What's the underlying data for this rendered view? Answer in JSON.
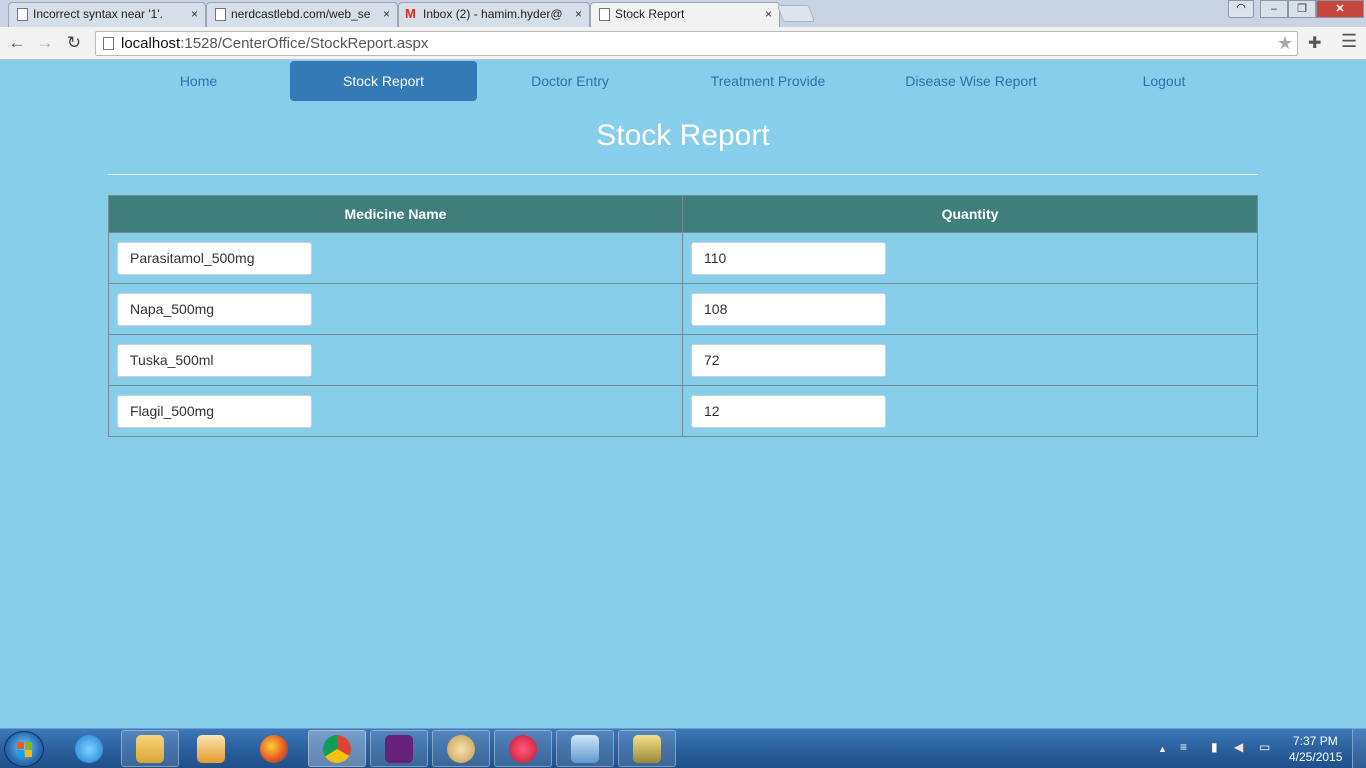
{
  "browser": {
    "tabs": [
      {
        "title": "Incorrect syntax near '1'.",
        "icon": "page-icon",
        "active": false
      },
      {
        "title": "nerdcastlebd.com/web_se",
        "icon": "page-icon",
        "active": false
      },
      {
        "title": "Inbox (2) - hamim.hyder@",
        "icon": "gmail-icon",
        "active": false
      },
      {
        "title": "Stock Report",
        "icon": "page-icon",
        "active": true
      }
    ],
    "close_glyph": "×",
    "url_host": "localhost",
    "url_path": ":1528/CenterOffice/StockReport.aspx"
  },
  "nav": {
    "items": [
      {
        "label": "Home",
        "active": false
      },
      {
        "label": "Stock Report",
        "active": true
      },
      {
        "label": "Doctor Entry",
        "active": false
      },
      {
        "label": "Treatment Provide",
        "active": false
      },
      {
        "label": "Disease Wise Report",
        "active": false
      },
      {
        "label": "Logout",
        "active": false
      }
    ]
  },
  "page": {
    "title": "Stock Report"
  },
  "table": {
    "headers": [
      "Medicine Name",
      "Quantity"
    ],
    "rows": [
      {
        "name": "Parasitamol_500mg",
        "quantity": "110"
      },
      {
        "name": "Napa_500mg",
        "quantity": "108"
      },
      {
        "name": "Tuska_500ml",
        "quantity": "72"
      },
      {
        "name": "Flagil_500mg",
        "quantity": "12"
      }
    ]
  },
  "taskbar": {
    "apps": [
      "internet-explorer",
      "file-explorer",
      "media-player",
      "firefox",
      "chrome",
      "visual-studio",
      "paint",
      "itunes",
      "remote-desktop",
      "sql-tool"
    ],
    "clock_time": "7:37 PM",
    "clock_date": "4/25/2015"
  },
  "colors": {
    "page_background": "#87CEEB",
    "nav_active": "#337ab7",
    "nav_link": "#2f6fb0",
    "table_header": "#407e7b"
  }
}
